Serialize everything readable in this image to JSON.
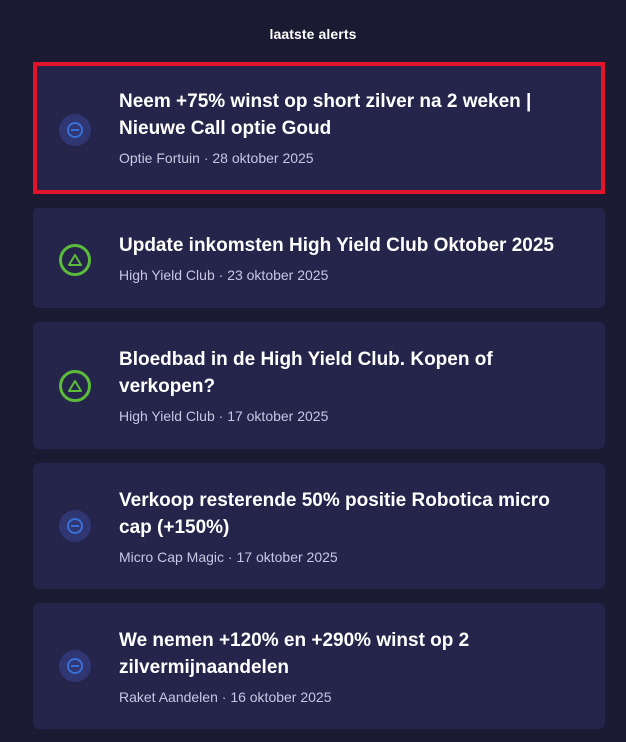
{
  "header": {
    "title": "laatste alerts"
  },
  "alerts": [
    {
      "title": "Neem +75% winst op short zilver na 2 weken | Nieuwe Call optie Goud",
      "source": "Optie Fortuin",
      "date": "28 oktober 2025",
      "icon": "minus-circle-icon"
    },
    {
      "title": "Update inkomsten High Yield Club Oktober 2025",
      "source": "High Yield Club",
      "date": "23 oktober 2025",
      "icon": "triangle-up-icon"
    },
    {
      "title": "Bloedbad in de High Yield Club. Kopen of verkopen?",
      "source": "High Yield Club",
      "date": "17 oktober 2025",
      "icon": "triangle-up-icon"
    },
    {
      "title": "Verkoop resterende 50% positie Robotica micro cap (+150%)",
      "source": "Micro Cap Magic",
      "date": "17 oktober 2025",
      "icon": "minus-circle-icon"
    },
    {
      "title": "We nemen +120% en +290% winst op 2 zilvermijnaandelen",
      "source": "Raket Aandelen",
      "date": "16 oktober 2025",
      "icon": "minus-circle-icon"
    }
  ],
  "meta_separator": " · ",
  "colors": {
    "background": "#1a1a33",
    "card": "#25244a",
    "selection": "#e0152b",
    "up": "#5bbb3a",
    "neutral": "#3a6fd8"
  }
}
